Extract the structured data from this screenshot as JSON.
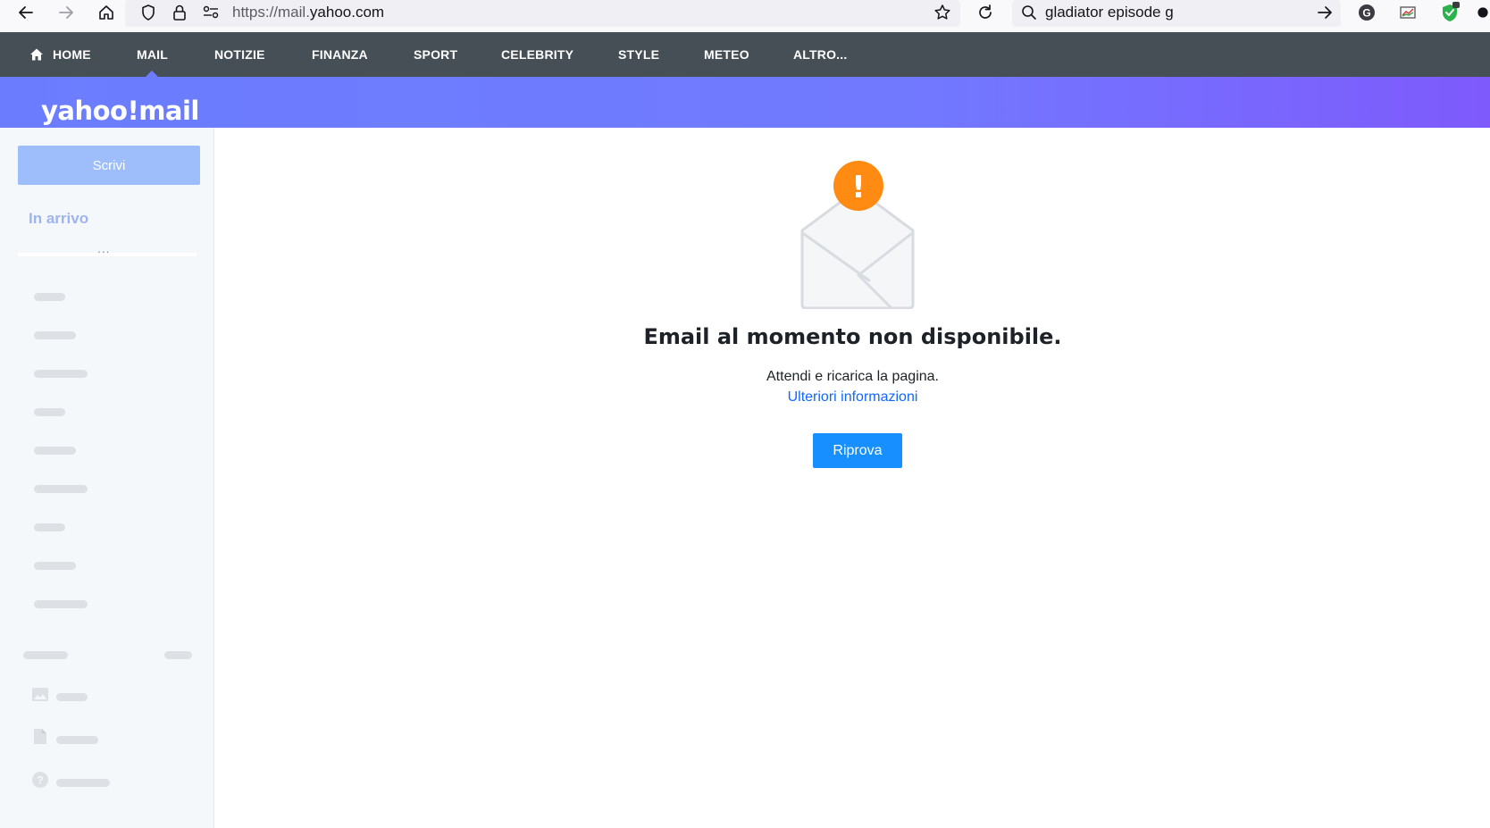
{
  "browser": {
    "url_prefix": "https://mail.",
    "url_domain": "yahoo.com",
    "search_query": "gladiator episode g",
    "icons": [
      "back-arrow-icon",
      "forward-arrow-icon",
      "home-icon",
      "shield-icon",
      "lock-icon",
      "permissions-icon",
      "star-icon",
      "reload-icon",
      "search-icon",
      "go-arrow-icon",
      "grammarly-icon",
      "chart-extension-icon",
      "shield-check-extension-icon",
      "extensions-icon"
    ],
    "grammarly_letter": "G"
  },
  "nav": {
    "items": [
      "HOME",
      "MAIL",
      "NOTIZIE",
      "FINANZA",
      "SPORT",
      "CELEBRITY",
      "STYLE",
      "METEO",
      "ALTRO..."
    ],
    "active": "MAIL"
  },
  "brand": {
    "logo_text": "yahoo!mail",
    "banner_colors": [
      "#6b7dfe",
      "#7e5afc"
    ]
  },
  "sidebar": {
    "compose_label": "Scrivi",
    "inbox_label": "In arrivo",
    "more_dots": "...",
    "compose_color": "#9dbefa"
  },
  "error": {
    "title": "Email al momento non disponibile.",
    "subtitle": "Attendi e ricarica la pagina.",
    "link_label": "Ulteriori informazioni",
    "retry_label": "Riprova",
    "badge_symbol": "!",
    "badge_color": "#ff8b12",
    "button_color": "#188fff"
  }
}
